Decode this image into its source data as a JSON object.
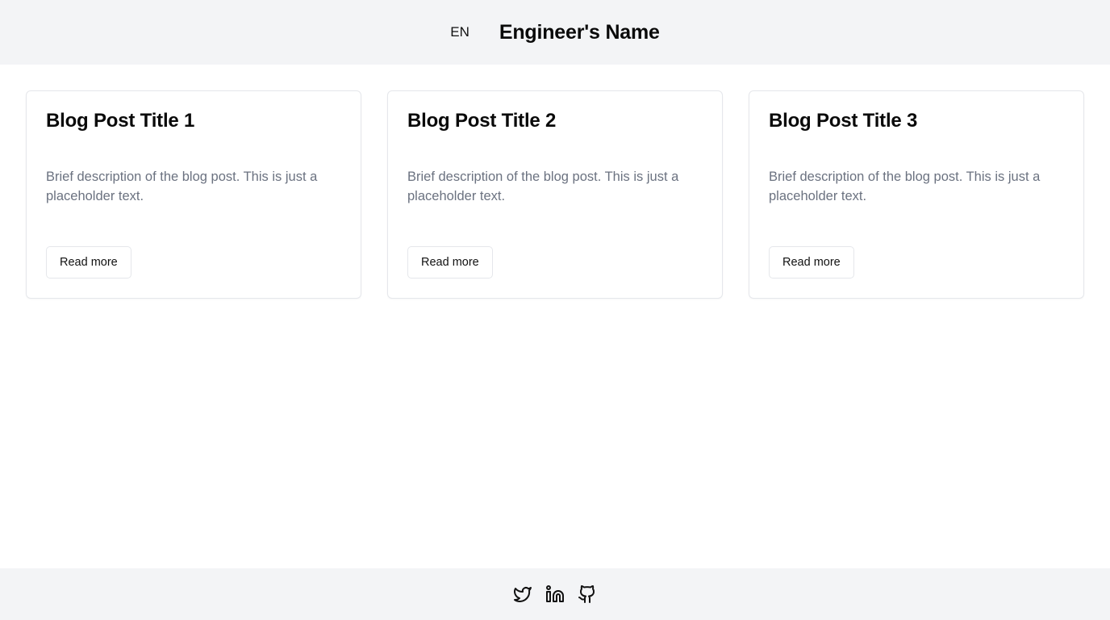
{
  "header": {
    "language": "EN",
    "site_title": "Engineer's Name"
  },
  "posts": [
    {
      "title": "Blog Post Title 1",
      "description": "Brief description of the blog post. This is just a placeholder text.",
      "button_label": "Read more"
    },
    {
      "title": "Blog Post Title 2",
      "description": "Brief description of the blog post. This is just a placeholder text.",
      "button_label": "Read more"
    },
    {
      "title": "Blog Post Title 3",
      "description": "Brief description of the blog post. This is just a placeholder text.",
      "button_label": "Read more"
    }
  ],
  "footer": {
    "social_icons": [
      "twitter-icon",
      "linkedin-icon",
      "github-icon"
    ]
  },
  "colors": {
    "header_bg": "#f3f4f6",
    "footer_bg": "#f3f4f6",
    "card_border": "#e5e7eb",
    "description_text": "#6b7280"
  }
}
